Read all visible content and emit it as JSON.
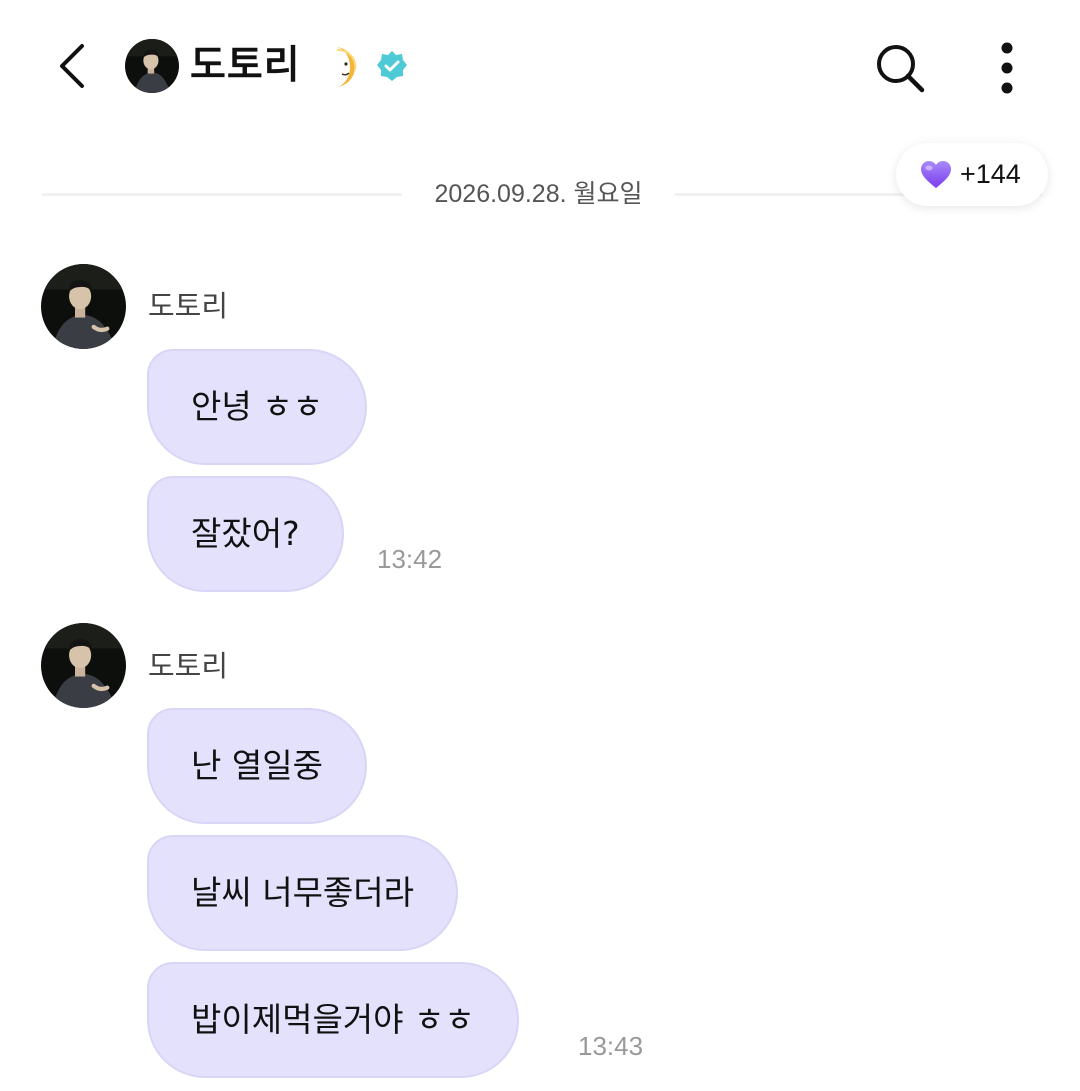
{
  "header": {
    "name": "도토리",
    "back_icon": "chevron-left-icon",
    "moon_icon": "crescent-moon-emoji",
    "verified_icon": "verified-badge-icon",
    "search_icon": "search-icon",
    "more_icon": "more-vertical-icon"
  },
  "date_divider": "2026.09.28. 월요일",
  "heart": {
    "icon": "purple-heart-emoji",
    "count": "+144"
  },
  "groups": [
    {
      "sender": "도토리",
      "messages": [
        "안녕 ㅎㅎ",
        "잘잤어?"
      ],
      "time": "13:42"
    },
    {
      "sender": "도토리",
      "messages": [
        "난 열일중",
        "날씨 너무좋더라",
        "밥이제먹을거야 ㅎㅎ"
      ],
      "time": "13:43"
    }
  ],
  "colors": {
    "bubble": "#e3e1fb",
    "bubble_border": "#d8d5f6",
    "verified": "#4ec9d6",
    "heart": "#8b5cf6",
    "moon": "#f4b63c"
  }
}
